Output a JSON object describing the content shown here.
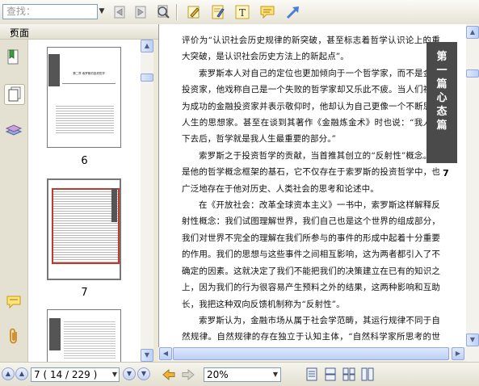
{
  "toolbar": {
    "search_placeholder": "查找：",
    "icons": [
      "search-dropdown-icon",
      "previous-result-icon",
      "next-result-icon",
      "find-icon",
      "highlight-tool-icon",
      "note-tool-icon",
      "text-tool-icon",
      "comment-tool-icon",
      "select-arrow-icon"
    ]
  },
  "left_panel": {
    "title": "页面",
    "collapse_label": "«",
    "thumbnails": [
      {
        "page_label": "6",
        "heading": "第二章 索罗斯的投资哲学",
        "selected": false
      },
      {
        "page_label": "7",
        "selected": true
      },
      {
        "page_label": "",
        "selected": false
      }
    ]
  },
  "document": {
    "paragraphs": [
      "评价为“认识社会历史规律的新突破，甚至标志着哲学认识论上的重大突破，是认识社会历史方法上的新起点”。",
      "索罗斯本人对自己的定位也更加倾向于一个哲学家，而不是金融投资家，他戏称自己是一个失败的哲学家却又乐此不疲。当人们视其为成功的金融投资家并表示敬仰时，他却认为自己更像一个不断思考人生的思想家。甚至在谈到其著作《金融炼金术》时也说：“我人倒下去后，哲学就是我人生最重要的部分。”",
      "索罗斯之于投资哲学的贡献，当首推其创立的“反射性”概念。这是他的哲学概念框架的基石，它不仅存在于索罗斯的投资哲学中，也广泛地存在于他对历史、人类社会的思考和论述中。",
      "在《开放社会：改革全球资本主义》一书中，索罗斯这样解释反射性概念：我们试图理解世界，我们自己也是这个世界的组成部分，我们对世界不完全的理解在我们所参与的事件的形成中起着十分重要的作用。我们的思想与这些事件之间相互影响，这为两者都引入了不确定的因素。这就决定了我们不能把我们的决策建立在已有的知识之上，因为我们的行为很容易产生预料之外的结果，这两种影响和互助长，我把这种双向反馈机制称为“反射性”。",
      "索罗斯认为，金融市场从属于社会学范畴，其运行规律不同于自然规律。自然规律的存在独立于认知主体，“自然科学家所思考的世界是一个独立于他们思想的世界。他们的陈述属于一个世界，而他们的陈述所涉及的事实则属于另一个世界。”在陈述与事实之间只存在单向的一致"
    ],
    "chapter_tab": "第一篇 心态篇",
    "page_number": "7"
  },
  "statusbar": {
    "page_field": "7 ( 14 / 229 )",
    "zoom": "20%"
  },
  "colors": {
    "thumb_highlight": "#c0392b",
    "chapter_tab_bg": "#4a4a4a",
    "scroll_blue": "#bcd0f6"
  }
}
